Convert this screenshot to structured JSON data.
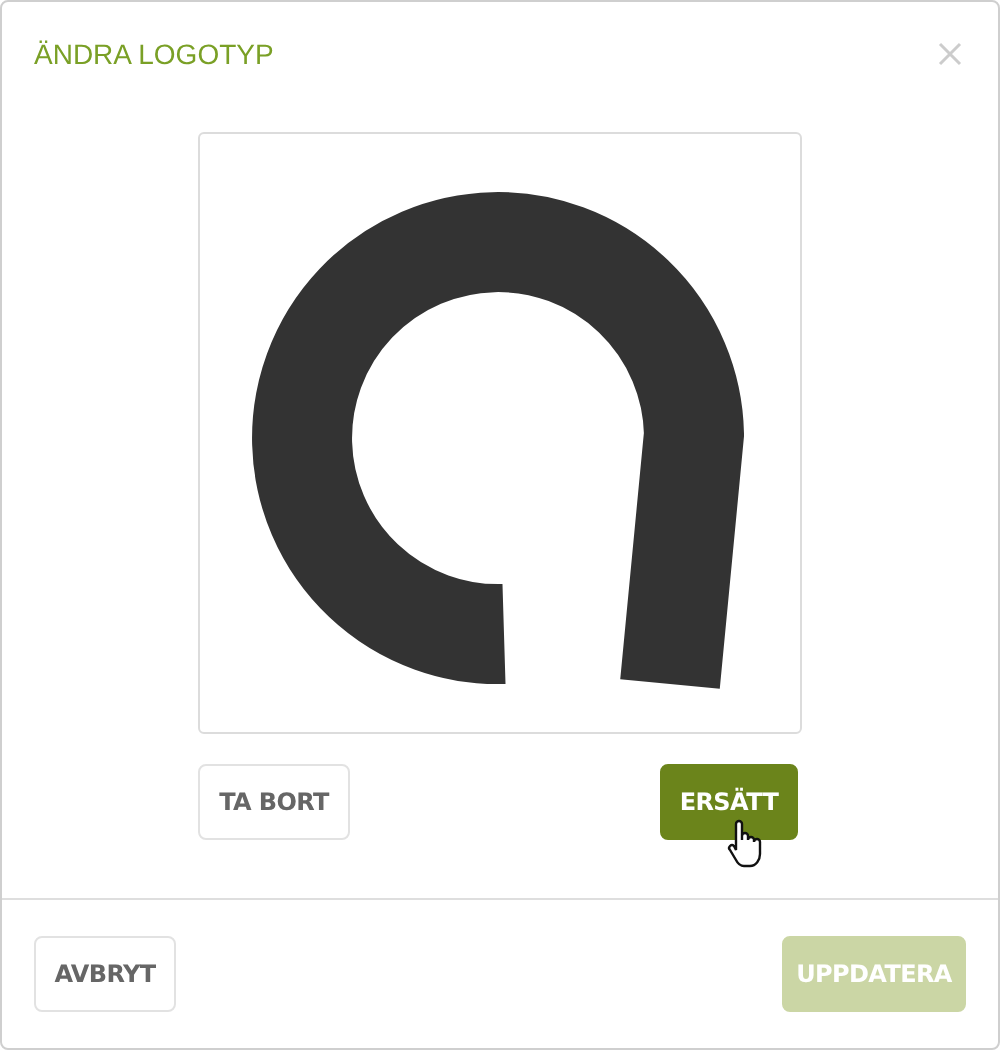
{
  "dialog": {
    "title": "ÄNDRA LOGOTYP"
  },
  "logo_actions": [
    {
      "label": "TA BORT",
      "kind": "secondary"
    },
    {
      "label": "ERSÄTT",
      "kind": "primary"
    }
  ],
  "footer_buttons": [
    {
      "label": "AVBRYT",
      "kind": "secondary",
      "disabled": false
    },
    {
      "label": "UPPDATERA",
      "kind": "primary",
      "disabled": true
    }
  ]
}
